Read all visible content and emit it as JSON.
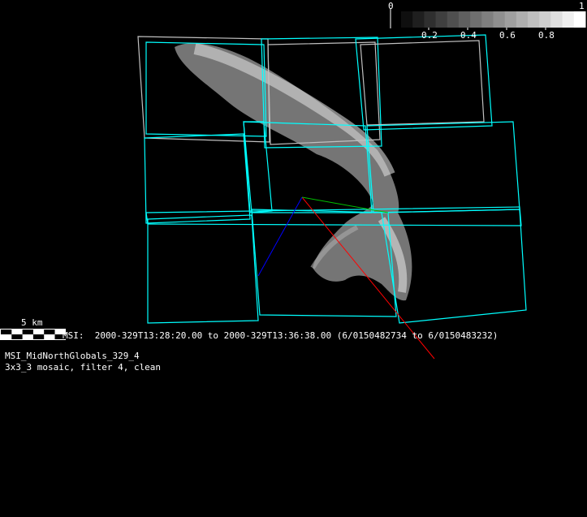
{
  "colorbar": {
    "min_label": "0",
    "max_label": "1",
    "ticks": [
      "0.2",
      "0.4",
      "0.6",
      "0.8"
    ],
    "steps": 16
  },
  "scale_bar": {
    "label": "5 km"
  },
  "observation": {
    "line": "MSI:  2000-329T13:28:20.00 to 2000-329T13:36:38.00 (6/0150482734 to 6/0150483232)"
  },
  "sequence": {
    "name": "MSI_MidNorthGlobals_329_4",
    "description": "3x3_3 mosaic, filter 4, clean"
  },
  "colors": {
    "footprint": "#00ffff",
    "footprint_alt": "#c0c0c0",
    "axis_x": "#ff0000",
    "axis_y": "#00c000",
    "axis_z": "#0000ff"
  }
}
